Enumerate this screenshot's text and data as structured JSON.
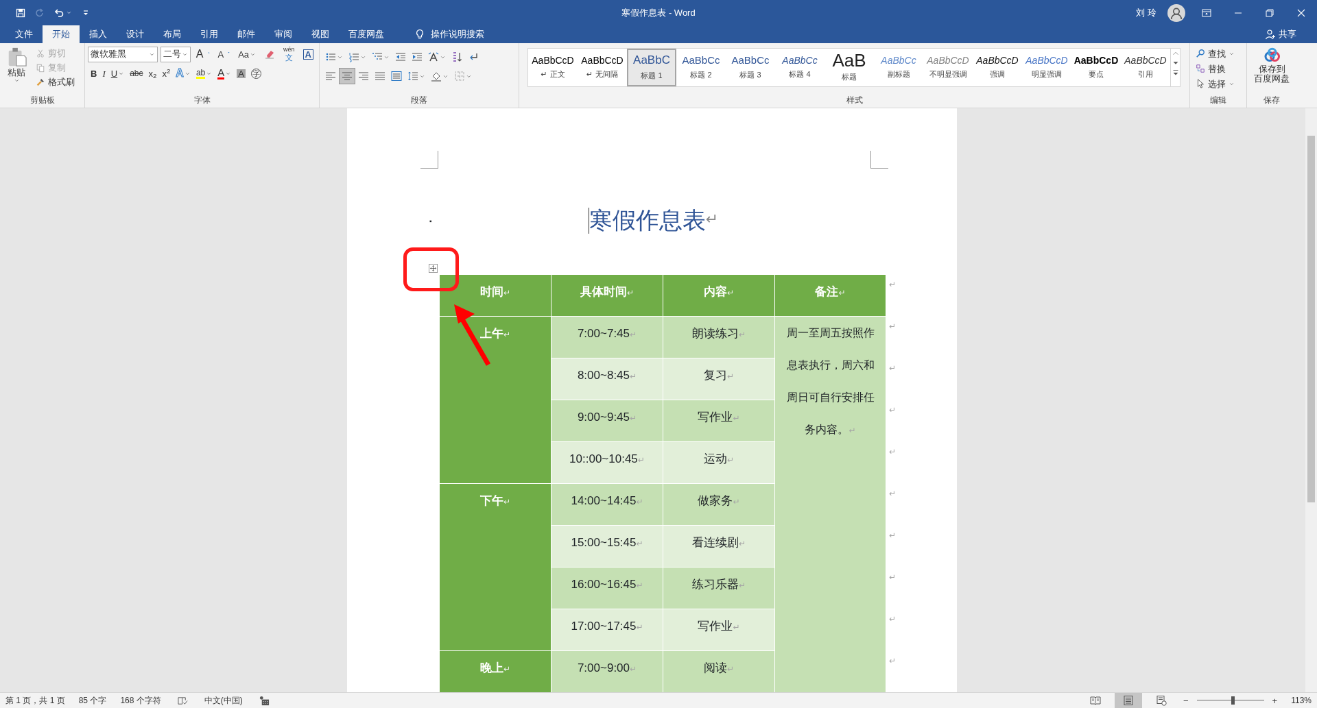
{
  "window": {
    "title": "寒假作息表 - Word",
    "user": "刘 玲"
  },
  "quick_access": [
    {
      "kind": "save",
      "disabled": false
    },
    {
      "kind": "redo",
      "disabled": true
    },
    {
      "kind": "undo",
      "disabled": false,
      "dropdown": true
    },
    {
      "kind": "customize",
      "disabled": false
    }
  ],
  "tabs": [
    {
      "label": "文件",
      "selected": false
    },
    {
      "label": "开始",
      "selected": true
    },
    {
      "label": "插入",
      "selected": false
    },
    {
      "label": "设计",
      "selected": false
    },
    {
      "label": "布局",
      "selected": false
    },
    {
      "label": "引用",
      "selected": false
    },
    {
      "label": "邮件",
      "selected": false
    },
    {
      "label": "审阅",
      "selected": false
    },
    {
      "label": "视图",
      "selected": false
    },
    {
      "label": "百度网盘",
      "selected": false
    }
  ],
  "tell_me": {
    "label": "操作说明搜索"
  },
  "share": {
    "label": "共享"
  },
  "ribbon": {
    "clipboard": {
      "label": "剪贴板",
      "paste": "粘贴",
      "items": [
        {
          "kind": "cut",
          "label": "剪切",
          "disabled": true
        },
        {
          "kind": "copy",
          "label": "复制",
          "disabled": true
        },
        {
          "kind": "painter",
          "label": "格式刷",
          "disabled": false
        }
      ]
    },
    "font": {
      "label": "字体",
      "font_name": "微软雅黑",
      "font_size": "二号",
      "row_1": [
        {
          "kind": "grow",
          "label": "A"
        },
        {
          "kind": "shrink",
          "label": "A"
        },
        {
          "kind": "case",
          "label": "Aa",
          "dropdown": true
        },
        {
          "kind": "clear"
        },
        {
          "kind": "phonetic",
          "label": "wén",
          "sub": "文"
        },
        {
          "kind": "border",
          "label": "A"
        }
      ],
      "row_2": [
        {
          "kind": "bold",
          "label": "B"
        },
        {
          "kind": "italic",
          "label": "I"
        },
        {
          "kind": "underline",
          "label": "U",
          "dropdown": true
        },
        {
          "kind": "strike",
          "label": "abc"
        },
        {
          "kind": "subscript",
          "label": "x$_{2}$"
        },
        {
          "kind": "superscript",
          "label": "x$^{2}$"
        },
        {
          "kind": "effects",
          "label": "A",
          "dropdown": true
        },
        {
          "kind": "highlight",
          "label": "ab",
          "dropdown": true
        },
        {
          "kind": "color",
          "label": "A",
          "dropdown": true
        },
        {
          "kind": "shade",
          "label": "A"
        },
        {
          "kind": "enclose",
          "label": "字"
        }
      ]
    },
    "paragraph": {
      "label": "段落",
      "row_1": [
        {
          "kind": "bullets",
          "dropdown": true
        },
        {
          "kind": "numbering",
          "dropdown": true
        },
        {
          "kind": "multilevel",
          "dropdown": true
        },
        {
          "kind": "outdent"
        },
        {
          "kind": "indent"
        },
        {
          "kind": "asian-layout",
          "dropdown": true
        },
        {
          "kind": "sort"
        },
        {
          "kind": "marks"
        }
      ],
      "alignment": [
        {
          "kind": "align-left",
          "selected": false
        },
        {
          "kind": "align-center",
          "selected": true
        },
        {
          "kind": "align-right",
          "selected": false
        },
        {
          "kind": "justify",
          "selected": false
        },
        {
          "kind": "distribute",
          "selected": false
        }
      ],
      "row_2_tools": [
        {
          "kind": "spacing",
          "dropdown": true
        },
        {
          "kind": "shading",
          "dropdown": true
        },
        {
          "kind": "borders",
          "dropdown": true
        }
      ]
    },
    "styles": {
      "label": "样式",
      "items": [
        {
          "preview": "AaBbCcD",
          "name": "正文",
          "mark": "↵",
          "kind": "normal",
          "selected": false
        },
        {
          "preview": "AaBbCcD",
          "name": "无间隔",
          "mark": "↵",
          "kind": "nospace",
          "selected": false
        },
        {
          "preview": "AaBbC",
          "name": "标题 1",
          "kind": "h1",
          "selected": true
        },
        {
          "preview": "AaBbCc",
          "name": "标题 2",
          "kind": "h2",
          "selected": false
        },
        {
          "preview": "AaBbCc",
          "name": "标题 3",
          "kind": "h3",
          "selected": false
        },
        {
          "preview": "AaBbCc",
          "name": "标题 4",
          "kind": "h4",
          "selected": false
        },
        {
          "preview": "AaB",
          "name": "标题",
          "kind": "title",
          "selected": false
        },
        {
          "preview": "AaBbCc",
          "name": "副标题",
          "kind": "subtitle",
          "selected": false
        },
        {
          "preview": "AaBbCcD",
          "name": "不明显强调",
          "kind": "subtle",
          "selected": false
        },
        {
          "preview": "AaBbCcD",
          "name": "强调",
          "kind": "emphasis",
          "selected": false
        },
        {
          "preview": "AaBbCcD",
          "name": "明显强调",
          "kind": "intense",
          "selected": false
        },
        {
          "preview": "AaBbCcD",
          "name": "要点",
          "kind": "strong",
          "selected": false
        },
        {
          "preview": "AaBbCcD",
          "name": "引用",
          "kind": "quote",
          "selected": false
        }
      ]
    },
    "editing": {
      "label": "编辑",
      "items": [
        {
          "kind": "find",
          "label": "查找",
          "dropdown": true
        },
        {
          "kind": "replace",
          "label": "替换"
        },
        {
          "kind": "select",
          "label": "选择",
          "dropdown": true
        }
      ]
    },
    "save": {
      "label": "保存",
      "button_lines": [
        "保存到",
        "百度网盘"
      ]
    }
  },
  "document": {
    "title": {
      "bullet": "▪",
      "text": "寒假作息表",
      "mark": "↵"
    },
    "table": {
      "columns": [
        {
          "text": "时间",
          "mark": "↵"
        },
        {
          "text": "具体时间",
          "mark": "↵"
        },
        {
          "text": "内容",
          "mark": "↵"
        },
        {
          "text": "备注",
          "mark": "↵"
        }
      ],
      "header_end_mark": "↵",
      "groups": [
        {
          "label": "上午",
          "mark": "↵",
          "rows": [
            {
              "time": "7:00~7:45",
              "time_mark": "↵",
              "content": "朗读练习",
              "content_mark": "↵",
              "end_mark": "↵"
            },
            {
              "time": "8:00~8:45",
              "time_mark": "↵",
              "content": "复习",
              "content_mark": "↵",
              "end_mark": "↵"
            },
            {
              "time": "9:00~9:45",
              "time_mark": "↵",
              "content": "写作业",
              "content_mark": "↵",
              "end_mark": "↵"
            },
            {
              "time": "10::00~10:45",
              "time_mark": "↵",
              "content": "运动",
              "content_mark": "↵",
              "end_mark": "↵"
            }
          ]
        },
        {
          "label": "下午",
          "mark": "↵",
          "rows": [
            {
              "time": "14:00~14:45",
              "time_mark": "↵",
              "content": "做家务",
              "content_mark": "↵",
              "end_mark": "↵"
            },
            {
              "time": "15:00~15:45",
              "time_mark": "↵",
              "content": "看连续剧",
              "content_mark": "↵",
              "end_mark": "↵"
            },
            {
              "time": "16:00~16:45",
              "time_mark": "↵",
              "content": "练习乐器",
              "content_mark": "↵",
              "end_mark": "↵"
            },
            {
              "time": "17:00~17:45",
              "time_mark": "↵",
              "content": "写作业",
              "content_mark": "↵",
              "end_mark": "↵"
            }
          ]
        },
        {
          "label": "晚上",
          "mark": "↵",
          "rows": [
            {
              "time": "7:00~9:00",
              "time_mark": "↵",
              "content": "阅读",
              "content_mark": "↵",
              "end_mark": "↵"
            }
          ]
        }
      ],
      "note": {
        "text": "周一至周五按照作息表执行，周六和周日可自行安排任务内容。",
        "mark": "↵"
      }
    }
  },
  "status_bar": {
    "left": [
      {
        "kind": "text",
        "label": "第 1 页，共 1 页"
      },
      {
        "kind": "text",
        "label": "85 个字"
      },
      {
        "kind": "text",
        "label": "168 个字符"
      },
      {
        "kind": "proofing"
      },
      {
        "kind": "text",
        "label": "中文(中国)"
      },
      {
        "kind": "macro"
      }
    ],
    "views": [
      {
        "kind": "read",
        "selected": false
      },
      {
        "kind": "print",
        "selected": true
      },
      {
        "kind": "web",
        "selected": false
      }
    ],
    "zoom": {
      "minus": "−",
      "plus": "+",
      "level": 0.53,
      "reading": "113%"
    }
  }
}
